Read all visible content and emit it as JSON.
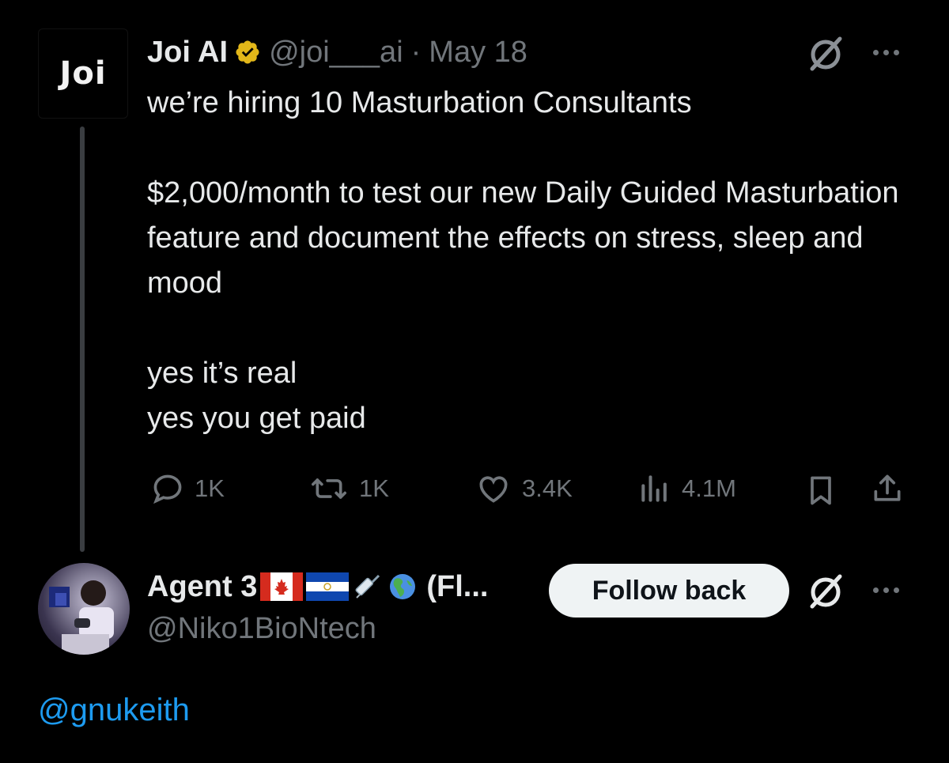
{
  "tweet": {
    "avatar_text": "Joi",
    "author_name": "Joi AI",
    "handle": "@joi___ai",
    "separator": "·",
    "date": "May 18",
    "text": "we’re hiring 10 Masturbation Consultants\n\n$2,000/month to test our new Daily Guided Masturbation feature and document the effects on stress, sleep and mood\n\nyes it’s real\nyes you get paid",
    "icons": [
      "verified-badge-icon",
      "grok-icon",
      "more-icon"
    ],
    "actions": {
      "replies": "1K",
      "reposts": "1K",
      "likes": "3.4K",
      "views": "4.1M"
    }
  },
  "reply": {
    "author_name_prefix": "Agent 3",
    "author_name_suffix": "(Fl...",
    "emoji": [
      "canada-flag-icon",
      "el-salvador-flag-icon",
      "syringe-icon",
      "globe-americas-icon"
    ],
    "handle": "@Niko1BioNtech",
    "follow_label": "Follow back",
    "text": "@gnukeith"
  },
  "colors": {
    "background": "#000000",
    "text": "#e7e9ea",
    "muted": "#71767b",
    "link": "#1d9bf0",
    "verified_gold": "#e2b719",
    "button_bg": "#eff3f4"
  }
}
